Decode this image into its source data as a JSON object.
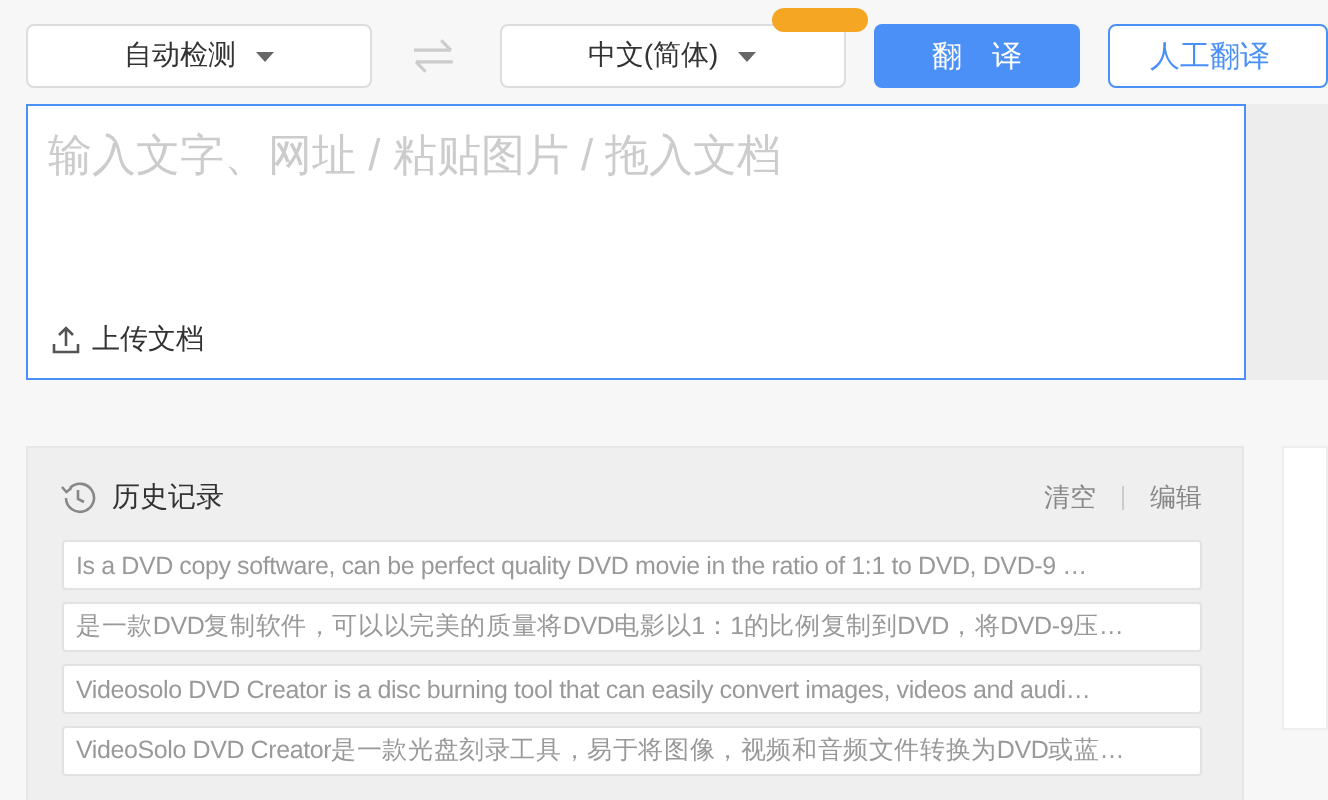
{
  "source_language": {
    "label": "自动检测"
  },
  "target_language": {
    "label": "中文(简体)"
  },
  "translate_button": "翻　译",
  "human_translate_button": "人工翻译",
  "input": {
    "placeholder": "输入文字、网址 / 粘贴图片 / 拖入文档",
    "upload_label": "上传文档"
  },
  "history": {
    "title": "历史记录",
    "actions": [
      "清空",
      "编辑"
    ],
    "items": [
      "Is a DVD copy software, can be perfect quality DVD movie in the ratio of 1:1 to DVD, DVD-9 …",
      "是一款DVD复制软件，可以以完美的质量将DVD电影以1：1的比例复制到DVD，将DVD-9压…",
      "Videosolo DVD Creator is a disc burning tool that can easily convert images, videos and audi…",
      "VideoSolo DVD Creator是一款光盘刻录工具，易于将图像，视频和音频文件转换为DVD或蓝…"
    ]
  }
}
